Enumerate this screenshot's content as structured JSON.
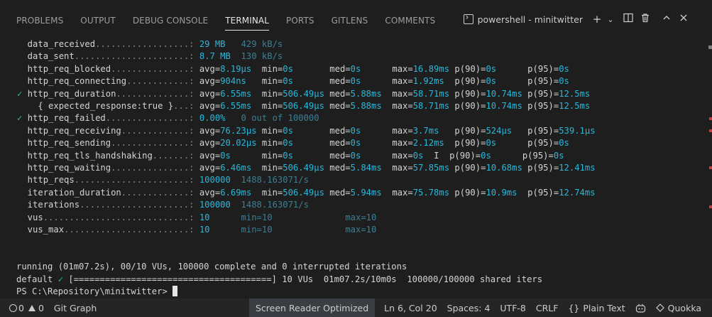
{
  "panel": {
    "tabs": [
      {
        "label": "PROBLEMS",
        "active": false
      },
      {
        "label": "OUTPUT",
        "active": false
      },
      {
        "label": "DEBUG CONSOLE",
        "active": false
      },
      {
        "label": "TERMINAL",
        "active": true
      },
      {
        "label": "PORTS",
        "active": false
      },
      {
        "label": "GITLENS",
        "active": false
      },
      {
        "label": "COMMENTS",
        "active": false
      }
    ],
    "terminal_name": "powershell - minitwitter",
    "icons": {
      "add": "+",
      "dropdown": "⌄",
      "split": "◫",
      "trash": "🗑",
      "maximize": "∧",
      "close": "✕"
    }
  },
  "terminal": {
    "lines": [
      {
        "segs": [
          {
            "t": "     data_received",
            "c": "w"
          },
          {
            "t": "..................:",
            "c": "d"
          },
          {
            "t": " 29 MB ",
            "c": "c"
          },
          {
            "t": "  429 kB/s",
            "c": "cd"
          }
        ]
      },
      {
        "segs": [
          {
            "t": "     data_sent",
            "c": "w"
          },
          {
            "t": "......................:",
            "c": "d"
          },
          {
            "t": " 8.7 MB ",
            "c": "c"
          },
          {
            "t": " 130 kB/s",
            "c": "cd"
          }
        ]
      },
      {
        "segs": [
          {
            "t": "     http_req_blocked",
            "c": "w"
          },
          {
            "t": "...............:",
            "c": "d"
          },
          {
            "t": " avg=",
            "c": "w"
          },
          {
            "t": "8.19µs",
            "c": "c"
          },
          {
            "t": "  min=",
            "c": "w"
          },
          {
            "t": "0s",
            "c": "c"
          },
          {
            "t": "       med=",
            "c": "w"
          },
          {
            "t": "0s",
            "c": "c"
          },
          {
            "t": "      max=",
            "c": "w"
          },
          {
            "t": "16.89ms",
            "c": "c"
          },
          {
            "t": " p(90)=",
            "c": "w"
          },
          {
            "t": "0s",
            "c": "c"
          },
          {
            "t": "      p(95)=",
            "c": "w"
          },
          {
            "t": "0s",
            "c": "c"
          }
        ]
      },
      {
        "segs": [
          {
            "t": "     http_req_connecting",
            "c": "w"
          },
          {
            "t": "............:",
            "c": "d"
          },
          {
            "t": " avg=",
            "c": "w"
          },
          {
            "t": "904ns",
            "c": "c"
          },
          {
            "t": "   min=",
            "c": "w"
          },
          {
            "t": "0s",
            "c": "c"
          },
          {
            "t": "       med=",
            "c": "w"
          },
          {
            "t": "0s",
            "c": "c"
          },
          {
            "t": "      max=",
            "c": "w"
          },
          {
            "t": "1.92ms",
            "c": "c"
          },
          {
            "t": "  p(90)=",
            "c": "w"
          },
          {
            "t": "0s",
            "c": "c"
          },
          {
            "t": "      p(95)=",
            "c": "w"
          },
          {
            "t": "0s",
            "c": "c"
          }
        ]
      },
      {
        "segs": [
          {
            "t": "   ✓ ",
            "c": "g"
          },
          {
            "t": "http_req_duration",
            "c": "w"
          },
          {
            "t": "..............:",
            "c": "d"
          },
          {
            "t": " avg=",
            "c": "w"
          },
          {
            "t": "6.55ms",
            "c": "c"
          },
          {
            "t": "  min=",
            "c": "w"
          },
          {
            "t": "506.49µs",
            "c": "c"
          },
          {
            "t": " med=",
            "c": "w"
          },
          {
            "t": "5.88ms",
            "c": "c"
          },
          {
            "t": "  max=",
            "c": "w"
          },
          {
            "t": "58.71ms",
            "c": "c"
          },
          {
            "t": " p(90)=",
            "c": "w"
          },
          {
            "t": "10.74ms",
            "c": "c"
          },
          {
            "t": " p(95)=",
            "c": "w"
          },
          {
            "t": "12.5ms",
            "c": "c"
          }
        ]
      },
      {
        "segs": [
          {
            "t": "       { expected_response:true }",
            "c": "w"
          },
          {
            "t": "...:",
            "c": "d"
          },
          {
            "t": " avg=",
            "c": "w"
          },
          {
            "t": "6.55ms",
            "c": "c"
          },
          {
            "t": "  min=",
            "c": "w"
          },
          {
            "t": "506.49µs",
            "c": "c"
          },
          {
            "t": " med=",
            "c": "w"
          },
          {
            "t": "5.88ms",
            "c": "c"
          },
          {
            "t": "  max=",
            "c": "w"
          },
          {
            "t": "58.71ms",
            "c": "c"
          },
          {
            "t": " p(90)=",
            "c": "w"
          },
          {
            "t": "10.74ms",
            "c": "c"
          },
          {
            "t": " p(95)=",
            "c": "w"
          },
          {
            "t": "12.5ms",
            "c": "c"
          }
        ]
      },
      {
        "segs": [
          {
            "t": "   ✓ ",
            "c": "g"
          },
          {
            "t": "http_req_failed",
            "c": "w"
          },
          {
            "t": "................:",
            "c": "d"
          },
          {
            "t": " 0.00% ",
            "c": "c"
          },
          {
            "t": "  0 out of 100000",
            "c": "cd"
          }
        ]
      },
      {
        "segs": [
          {
            "t": "     http_req_receiving",
            "c": "w"
          },
          {
            "t": ".............:",
            "c": "d"
          },
          {
            "t": " avg=",
            "c": "w"
          },
          {
            "t": "76.23µs",
            "c": "c"
          },
          {
            "t": " min=",
            "c": "w"
          },
          {
            "t": "0s",
            "c": "c"
          },
          {
            "t": "       med=",
            "c": "w"
          },
          {
            "t": "0s",
            "c": "c"
          },
          {
            "t": "      max=",
            "c": "w"
          },
          {
            "t": "3.7ms",
            "c": "c"
          },
          {
            "t": "   p(90)=",
            "c": "w"
          },
          {
            "t": "524µs",
            "c": "c"
          },
          {
            "t": "   p(95)=",
            "c": "w"
          },
          {
            "t": "539.1µs",
            "c": "c"
          }
        ]
      },
      {
        "segs": [
          {
            "t": "     http_req_sending",
            "c": "w"
          },
          {
            "t": "...............:",
            "c": "d"
          },
          {
            "t": " avg=",
            "c": "w"
          },
          {
            "t": "20.02µs",
            "c": "c"
          },
          {
            "t": " min=",
            "c": "w"
          },
          {
            "t": "0s",
            "c": "c"
          },
          {
            "t": "       med=",
            "c": "w"
          },
          {
            "t": "0s",
            "c": "c"
          },
          {
            "t": "      max=",
            "c": "w"
          },
          {
            "t": "2.12ms",
            "c": "c"
          },
          {
            "t": "  p(90)=",
            "c": "w"
          },
          {
            "t": "0s",
            "c": "c"
          },
          {
            "t": "      p(95)=",
            "c": "w"
          },
          {
            "t": "0s",
            "c": "c"
          }
        ]
      },
      {
        "segs": [
          {
            "t": "     http_req_tls_handshaking",
            "c": "w"
          },
          {
            "t": ".......:",
            "c": "d"
          },
          {
            "t": " avg=",
            "c": "w"
          },
          {
            "t": "0s",
            "c": "c"
          },
          {
            "t": "      min=",
            "c": "w"
          },
          {
            "t": "0s",
            "c": "c"
          },
          {
            "t": "       med=",
            "c": "w"
          },
          {
            "t": "0s",
            "c": "c"
          },
          {
            "t": "      max=",
            "c": "w"
          },
          {
            "t": "0s",
            "c": "c"
          },
          {
            "t": "  I  ",
            "c": "w"
          },
          {
            "t": "p(90)=",
            "c": "w"
          },
          {
            "t": "0s",
            "c": "c"
          },
          {
            "t": "      p(95)=",
            "c": "w"
          },
          {
            "t": "0s",
            "c": "c"
          }
        ]
      },
      {
        "segs": [
          {
            "t": "     http_req_waiting",
            "c": "w"
          },
          {
            "t": "...............:",
            "c": "d"
          },
          {
            "t": " avg=",
            "c": "w"
          },
          {
            "t": "6.46ms",
            "c": "c"
          },
          {
            "t": "  min=",
            "c": "w"
          },
          {
            "t": "506.49µs",
            "c": "c"
          },
          {
            "t": " med=",
            "c": "w"
          },
          {
            "t": "5.84ms",
            "c": "c"
          },
          {
            "t": "  max=",
            "c": "w"
          },
          {
            "t": "57.85ms",
            "c": "c"
          },
          {
            "t": " p(90)=",
            "c": "w"
          },
          {
            "t": "10.68ms",
            "c": "c"
          },
          {
            "t": " p(95)=",
            "c": "w"
          },
          {
            "t": "12.41ms",
            "c": "c"
          }
        ]
      },
      {
        "segs": [
          {
            "t": "     http_reqs",
            "c": "w"
          },
          {
            "t": "......................:",
            "c": "d"
          },
          {
            "t": " 100000 ",
            "c": "c"
          },
          {
            "t": " 1488.163071/s",
            "c": "cd"
          }
        ]
      },
      {
        "segs": [
          {
            "t": "     iteration_duration",
            "c": "w"
          },
          {
            "t": ".............:",
            "c": "d"
          },
          {
            "t": " avg=",
            "c": "w"
          },
          {
            "t": "6.69ms",
            "c": "c"
          },
          {
            "t": "  min=",
            "c": "w"
          },
          {
            "t": "506.49µs",
            "c": "c"
          },
          {
            "t": " med=",
            "c": "w"
          },
          {
            "t": "5.94ms",
            "c": "c"
          },
          {
            "t": "  max=",
            "c": "w"
          },
          {
            "t": "75.78ms",
            "c": "c"
          },
          {
            "t": " p(90)=",
            "c": "w"
          },
          {
            "t": "10.9ms",
            "c": "c"
          },
          {
            "t": "  p(95)=",
            "c": "w"
          },
          {
            "t": "12.74ms",
            "c": "c"
          }
        ]
      },
      {
        "segs": [
          {
            "t": "     iterations",
            "c": "w"
          },
          {
            "t": ".....................:",
            "c": "d"
          },
          {
            "t": " 100000 ",
            "c": "c"
          },
          {
            "t": " 1488.163071/s",
            "c": "cd"
          }
        ]
      },
      {
        "segs": [
          {
            "t": "     vus",
            "c": "w"
          },
          {
            "t": "............................:",
            "c": "d"
          },
          {
            "t": " 10     ",
            "c": "c"
          },
          {
            "t": " min=10",
            "c": "cd"
          },
          {
            "t": "              ",
            "c": "w"
          },
          {
            "t": "max=10",
            "c": "cd"
          }
        ]
      },
      {
        "segs": [
          {
            "t": "     vus_max",
            "c": "w"
          },
          {
            "t": "........................:",
            "c": "d"
          },
          {
            "t": " 10     ",
            "c": "c"
          },
          {
            "t": " min=10",
            "c": "cd"
          },
          {
            "t": "              ",
            "c": "w"
          },
          {
            "t": "max=10",
            "c": "cd"
          }
        ]
      },
      {
        "segs": [
          {
            "t": "",
            "c": "w"
          }
        ]
      },
      {
        "segs": [
          {
            "t": "",
            "c": "w"
          }
        ]
      },
      {
        "segs": [
          {
            "t": "running (01m07.2s), 00/10 VUs, 100000 complete and 0 interrupted iterations",
            "c": "w"
          }
        ]
      },
      {
        "segs": [
          {
            "t": "default ",
            "c": "w"
          },
          {
            "t": "✓",
            "c": "g"
          },
          {
            "t": " [======================================] 10 VUs  01m07.2s/10m0s  100000/100000 shared iters",
            "c": "w"
          }
        ]
      },
      {
        "segs": [
          {
            "t": "PS C:\\Repository\\minitwitter> ",
            "c": "w"
          }
        ]
      }
    ]
  },
  "statusbar": {
    "errors": "0",
    "warnings": "0",
    "git_graph": "Git Graph",
    "screen_reader": "Screen Reader Optimized",
    "cursor_pos": "Ln 6, Col 20",
    "spaces": "Spaces: 4",
    "encoding": "UTF-8",
    "eol": "CRLF",
    "language": "Plain Text",
    "quokka": "Quokka"
  },
  "colors": {
    "background": "#1e1e1e",
    "cyan": "#29b8db",
    "dim_cyan": "#3b7f95",
    "green": "#23d18b",
    "statusbar": "#252526"
  }
}
